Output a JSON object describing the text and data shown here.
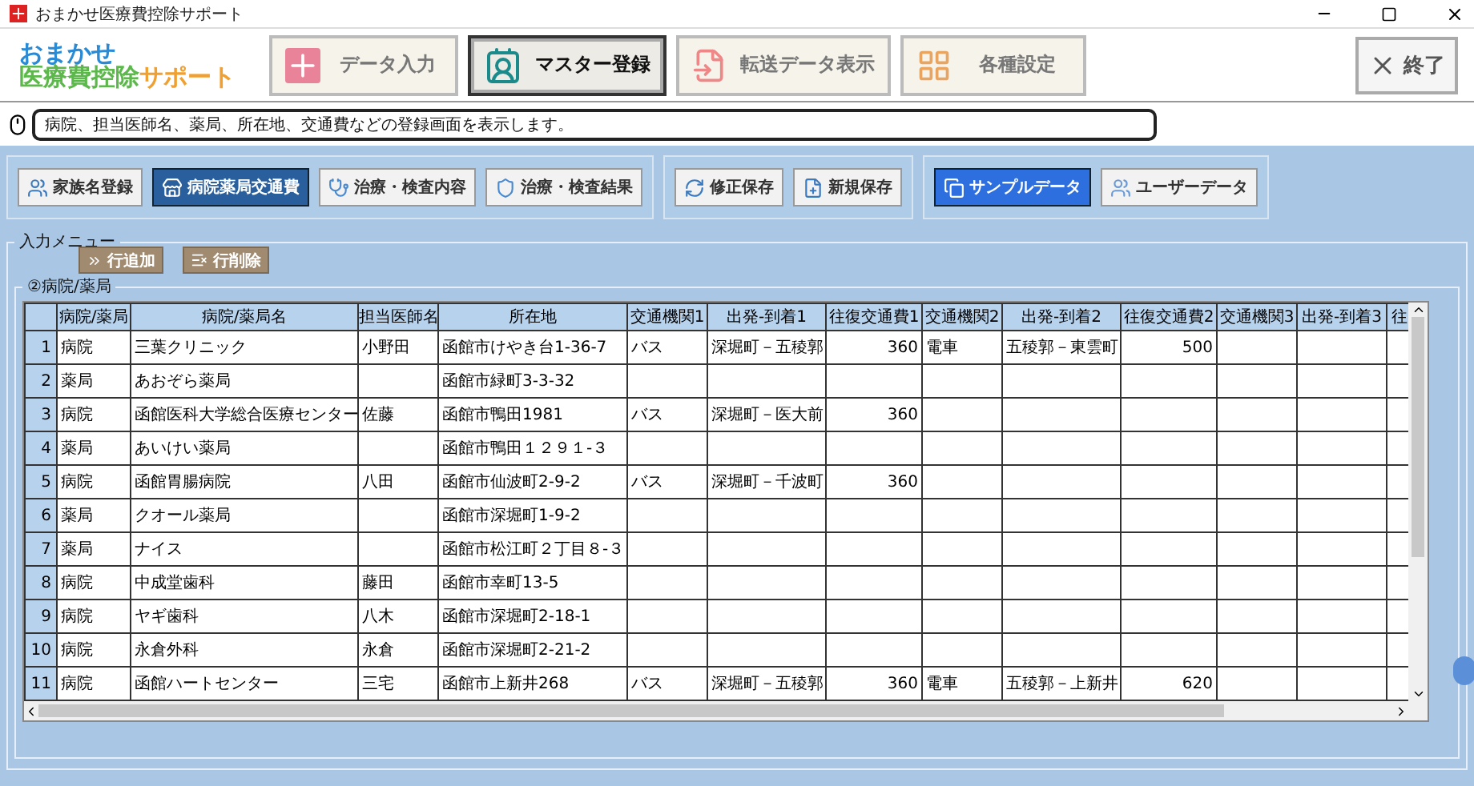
{
  "window": {
    "title": "おまかせ医療費控除サポート"
  },
  "logo": {
    "line1": "おまかせ",
    "line2a": "医療費控除",
    "line2b": "サポート"
  },
  "nav_tabs": [
    {
      "label": "データ入力",
      "kind": "plus",
      "selected": false
    },
    {
      "label": "マスター登録",
      "kind": "badge",
      "selected": true
    },
    {
      "label": "転送データ表示",
      "kind": "transfer",
      "selected": false
    },
    {
      "label": "各種設定",
      "kind": "grid",
      "selected": false
    }
  ],
  "exit_button": {
    "label": "終了"
  },
  "hint": {
    "text": "病院、担当医師名、薬局、所在地、交通費などの登録画面を表示します。"
  },
  "master_tabs": [
    {
      "label": "家族名登録",
      "kind": "family",
      "selected": false
    },
    {
      "label": "病院薬局交通費",
      "kind": "store",
      "selected": true
    },
    {
      "label": "治療・検査内容",
      "kind": "stethoscope",
      "selected": false
    },
    {
      "label": "治療・検査結果",
      "kind": "shield",
      "selected": false
    }
  ],
  "save_buttons": [
    {
      "label": "修正保存",
      "kind": "refresh"
    },
    {
      "label": "新規保存",
      "kind": "file"
    }
  ],
  "data_tabs": [
    {
      "label": "サンプルデータ",
      "kind": "copy",
      "selected": true
    },
    {
      "label": "ユーザーデータ",
      "kind": "users",
      "selected": false
    }
  ],
  "input_menu": {
    "title": "入力メニュー",
    "add_row": "行追加",
    "delete_row": "行削除"
  },
  "section": {
    "title": "②病院/薬局"
  },
  "table": {
    "columns": [
      "病院/薬局",
      "病院/薬局名",
      "担当医師名",
      "所在地",
      "交通機関1",
      "出発-到着1",
      "往復交通費1",
      "交通機関2",
      "出発-到着2",
      "往復交通費2",
      "交通機関3",
      "出発-到着3",
      "往"
    ],
    "rows": [
      {
        "number": "1",
        "cells": [
          "病院",
          "三葉クリニック",
          "小野田",
          "函館市けやき台1-36-7",
          "バス",
          "深堀町－五稜郭",
          "360",
          "電車",
          "五稜郭－東雲町",
          "500",
          null,
          null,
          null
        ]
      },
      {
        "number": "2",
        "cells": [
          "薬局",
          "あおぞら薬局",
          null,
          "函館市緑町3-3-32",
          null,
          null,
          null,
          null,
          null,
          null,
          null,
          null,
          null
        ]
      },
      {
        "number": "3",
        "cells": [
          "病院",
          "函館医科大学総合医療センター",
          "佐藤",
          "函館市鴨田1981",
          "バス",
          "深堀町－医大前",
          "360",
          null,
          null,
          null,
          null,
          null,
          null
        ]
      },
      {
        "number": "4",
        "cells": [
          "薬局",
          "あいけい薬局",
          null,
          "函館市鴨田１２９１-３",
          null,
          null,
          null,
          null,
          null,
          null,
          null,
          null,
          null
        ]
      },
      {
        "number": "5",
        "cells": [
          "病院",
          "函館胃腸病院",
          "八田",
          "函館市仙波町2-9-2",
          "バス",
          "深堀町－千波町",
          "360",
          null,
          null,
          null,
          null,
          null,
          null
        ]
      },
      {
        "number": "6",
        "cells": [
          "薬局",
          "クオール薬局",
          null,
          "函館市深堀町1-9-2",
          null,
          null,
          null,
          null,
          null,
          null,
          null,
          null,
          null
        ]
      },
      {
        "number": "7",
        "cells": [
          "薬局",
          "ナイス",
          null,
          "函館市松江町２丁目８-３",
          null,
          null,
          null,
          null,
          null,
          null,
          null,
          null,
          null
        ]
      },
      {
        "number": "8",
        "cells": [
          "病院",
          "中成堂歯科",
          "藤田",
          "函館市幸町13-5",
          null,
          null,
          null,
          null,
          null,
          null,
          null,
          null,
          null
        ]
      },
      {
        "number": "9",
        "cells": [
          "病院",
          "ヤギ歯科",
          "八木",
          "函館市深堀町2-18-1",
          null,
          null,
          null,
          null,
          null,
          null,
          null,
          null,
          null
        ]
      },
      {
        "number": "10",
        "cells": [
          "病院",
          "永倉外科",
          "永倉",
          "函館市深堀町2-21-2",
          null,
          null,
          null,
          null,
          null,
          null,
          null,
          null,
          null
        ]
      },
      {
        "number": "11",
        "cells": [
          "病院",
          "函館ハートセンター",
          "三宅",
          "函館市上新井268",
          "バス",
          "深堀町－五稜郭",
          "360",
          "電車",
          "五稜郭－上新井",
          "620",
          null,
          null,
          null
        ]
      }
    ]
  }
}
